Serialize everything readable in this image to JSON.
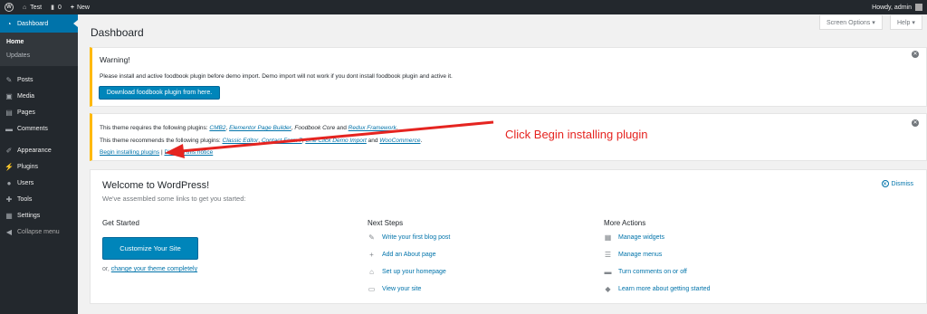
{
  "adminbar": {
    "site_name": "Test",
    "comments_count": "0",
    "new_label": "New",
    "howdy": "Howdy, admin"
  },
  "sidebar": {
    "dashboard_label": "Dashboard",
    "submenu": [
      "Home",
      "Updates"
    ],
    "items": [
      {
        "label": "Posts",
        "icon": "pin-icon"
      },
      {
        "label": "Media",
        "icon": "media-icon"
      },
      {
        "label": "Pages",
        "icon": "pages-icon"
      },
      {
        "label": "Comments",
        "icon": "comments-icon"
      },
      {
        "label": "Appearance",
        "icon": "brush-icon"
      },
      {
        "label": "Plugins",
        "icon": "plugin-icon"
      },
      {
        "label": "Users",
        "icon": "users-icon"
      },
      {
        "label": "Tools",
        "icon": "wrench-icon"
      },
      {
        "label": "Settings",
        "icon": "settings-icon"
      }
    ],
    "collapse_label": "Collapse menu"
  },
  "header": {
    "screen_options": "Screen Options ▾",
    "help": "Help ▾",
    "title": "Dashboard"
  },
  "notice_warning": {
    "heading": "Warning!",
    "message": "Please install and active foodbook plugin before demo import. Demo import will not work if you dont install foodbook plugin and active it.",
    "button": "Download foodbook plugin from here."
  },
  "notice_plugins": {
    "required_prefix": "This theme requires the following plugins:",
    "required": [
      "CMB2",
      "Elementor Page Builder",
      "Foodbook Core",
      "Redux Framework"
    ],
    "recommended_prefix": "This theme recommends the following plugins:",
    "recommended": [
      "Classic Editor",
      "Contact Form 7",
      "One Click Demo Import",
      "WooCommerce"
    ],
    "begin_link": "Begin installing plugins",
    "dismiss_link": "Dismiss this notice"
  },
  "annotation": {
    "text": "Click Begin installing plugin",
    "color": "#e52420"
  },
  "welcome": {
    "title": "Welcome to WordPress!",
    "subtitle": "We've assembled some links to get you started:",
    "dismiss": "Dismiss",
    "get_started": {
      "heading": "Get Started",
      "button": "Customize Your Site",
      "or_text": "or,",
      "change_theme": "change your theme completely"
    },
    "next_steps": {
      "heading": "Next Steps",
      "items": [
        {
          "label": "Write your first blog post",
          "icon": "edit-icon"
        },
        {
          "label": "Add an About page",
          "icon": "plus-icon"
        },
        {
          "label": "Set up your homepage",
          "icon": "home-icon"
        },
        {
          "label": "View your site",
          "icon": "view-site-icon"
        }
      ]
    },
    "more_actions": {
      "heading": "More Actions",
      "items": [
        {
          "label": "Manage widgets",
          "icon": "widgets-icon"
        },
        {
          "label": "Manage menus",
          "icon": "menus-icon"
        },
        {
          "label": "Turn comments on or off",
          "icon": "comment-toggle-icon"
        },
        {
          "label": "Learn more about getting started",
          "icon": "learn-icon"
        }
      ]
    }
  }
}
